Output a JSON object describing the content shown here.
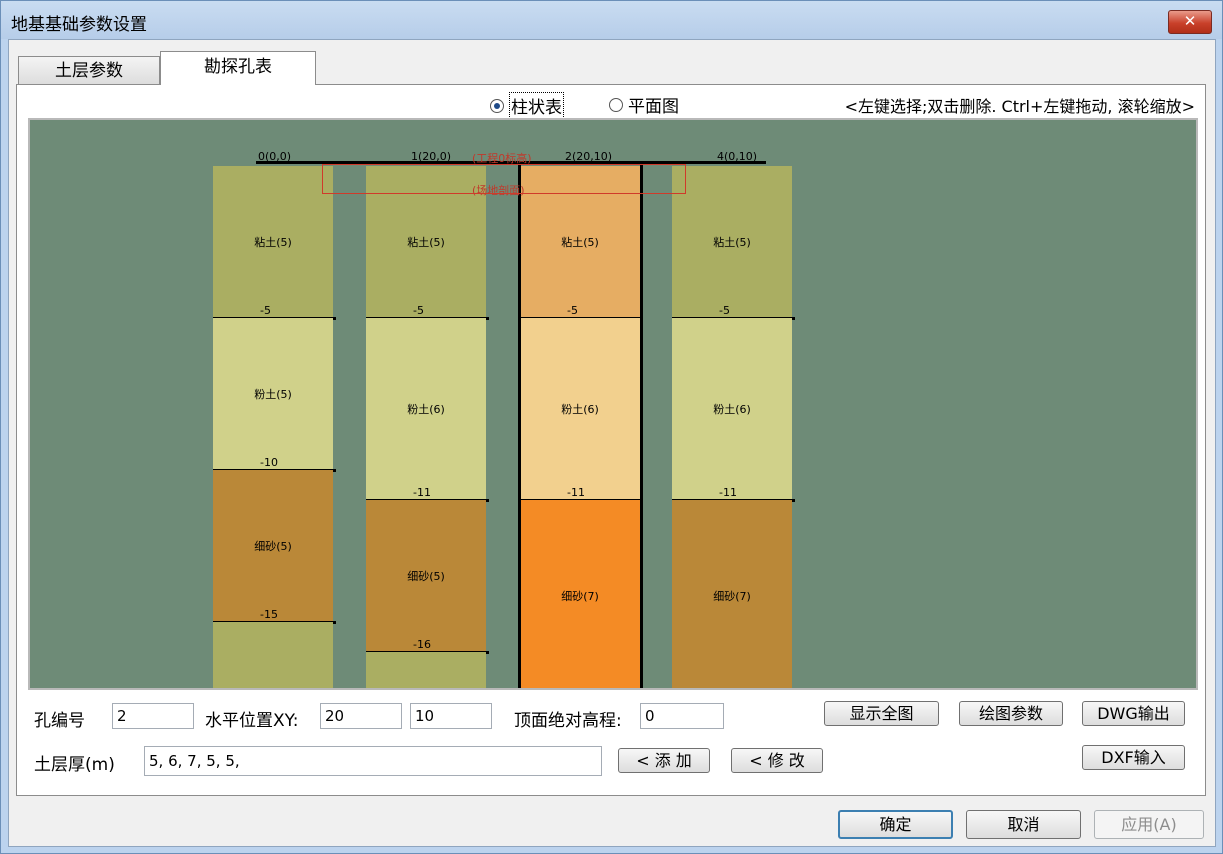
{
  "window": {
    "title": "地基基础参数设置",
    "close_label": "✕"
  },
  "tabs": [
    {
      "label": "土层参数",
      "active": false
    },
    {
      "label": "勘探孔表",
      "active": true
    }
  ],
  "view_options": [
    {
      "label": "柱状表",
      "selected": true
    },
    {
      "label": "平面图",
      "selected": false
    }
  ],
  "hint": "<左键选择;双击删除. Ctrl+左键拖动, 滚轮缩放>",
  "canvas": {
    "background": "#6e8b77",
    "annotations": {
      "zero_level": "(工程0标高)",
      "section": "(场地剖面)"
    },
    "holes": [
      {
        "label": "0(0,0)",
        "top": "0",
        "layers": [
          {
            "name": "粘土(5)",
            "bottom": "-5",
            "color": "#aaae62"
          },
          {
            "name": "粉土(5)",
            "bottom": "-10",
            "color": "#d0d18a"
          },
          {
            "name": "细砂(5)",
            "bottom": "-15",
            "color": "#ba8838"
          },
          {
            "name": "",
            "bottom": "",
            "color": "#aaae62"
          }
        ]
      },
      {
        "label": "1(20,0)",
        "top": "0",
        "layers": [
          {
            "name": "粘土(5)",
            "bottom": "-5",
            "color": "#aaae62"
          },
          {
            "name": "粉土(6)",
            "bottom": "-11",
            "color": "#d0d18a"
          },
          {
            "name": "细砂(5)",
            "bottom": "-16",
            "color": "#ba8838"
          },
          {
            "name": "",
            "bottom": "",
            "color": "#aaae62"
          }
        ]
      },
      {
        "label": "2(20,10)",
        "top": "0",
        "selected": true,
        "layers": [
          {
            "name": "粘土(5)",
            "bottom": "-5",
            "color": "#e6ad63"
          },
          {
            "name": "粉土(6)",
            "bottom": "-11",
            "color": "#f2d08e"
          },
          {
            "name": "细砂(7)",
            "bottom": "",
            "color": "#f48b25"
          }
        ]
      },
      {
        "label": "4(0,10)",
        "top": "0",
        "layers": [
          {
            "name": "粘土(5)",
            "bottom": "-5",
            "color": "#aaae62"
          },
          {
            "name": "粉土(6)",
            "bottom": "-11",
            "color": "#d0d18a"
          },
          {
            "name": "细砂(7)",
            "bottom": "",
            "color": "#ba8838"
          }
        ]
      }
    ]
  },
  "form": {
    "hole_no_label": "孔编号",
    "hole_no": "2",
    "xy_label": "水平位置XY:",
    "x": "20",
    "y": "10",
    "elev_label": "顶面绝对高程:",
    "elev": "0",
    "thick_label": "土层厚(m)",
    "thick": "5, 6, 7, 5, 5,",
    "add_btn": "< 添 加",
    "modify_btn": "< 修 改",
    "show_all_btn": "显示全图",
    "draw_params_btn": "绘图参数",
    "dwg_btn": "DWG输出",
    "dxf_btn": "DXF输入"
  },
  "footer": {
    "ok": "确定",
    "cancel": "取消",
    "apply": "应用(A)"
  }
}
